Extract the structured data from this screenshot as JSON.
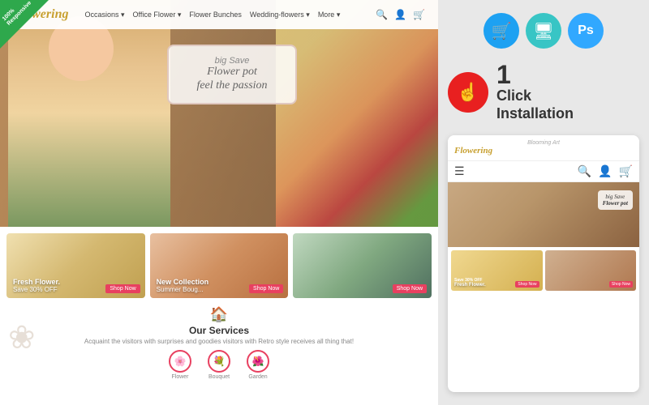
{
  "brand": {
    "name": "Flowering",
    "tagline": "Blooming Art"
  },
  "navbar": {
    "links": [
      "Occasions ▾",
      "Office Flower ▾",
      "Flower Bunches",
      "Wedding-flowers ▾",
      "More ▾"
    ]
  },
  "hero": {
    "small_text": "big Save",
    "main_text": "Flower pot",
    "sub_text": "feel the passion"
  },
  "product_cards": [
    {
      "title": "Fresh Flower.",
      "subtitle": "Save 30% OFF",
      "btn": "Shop Now"
    },
    {
      "title": "New Collection",
      "subtitle": "Summer Boug...",
      "btn": "Shop Now"
    },
    {
      "title": "",
      "subtitle": "",
      "btn": "Shop Now"
    }
  ],
  "services": {
    "title": "Our Services",
    "description": "Acquaint the visitors with surprises and goodies visitors with Retro style receives all thing that!"
  },
  "service_icons": [
    {
      "icon": "🌸",
      "label": "Flower"
    },
    {
      "icon": "💐",
      "label": "Bouquet"
    },
    {
      "icon": "🌺",
      "label": "Garden"
    }
  ],
  "responsive_badge": {
    "line1": "100%",
    "line2": "Responsive"
  },
  "top_icons": [
    {
      "symbol": "🛒",
      "color": "icon-circle-blue",
      "name": "cart-icon"
    },
    {
      "symbol": "🖥",
      "color": "icon-circle-teal",
      "name": "desktop-icon"
    },
    {
      "symbol": "Ps",
      "color": "icon-circle-ps",
      "name": "photoshop-icon"
    }
  ],
  "click_install": {
    "number": "1",
    "label": "Click\nInstallation",
    "btn_symbol": "👆"
  },
  "mobile_preview": {
    "brand": "Flowering",
    "tagline": "Blooming Art",
    "hero_text": "big Save\nFlower pot",
    "card1_title": "Fresh Flower.",
    "card1_sub": "Save 30% OFF",
    "card2_title": "",
    "card2_sub": ""
  }
}
